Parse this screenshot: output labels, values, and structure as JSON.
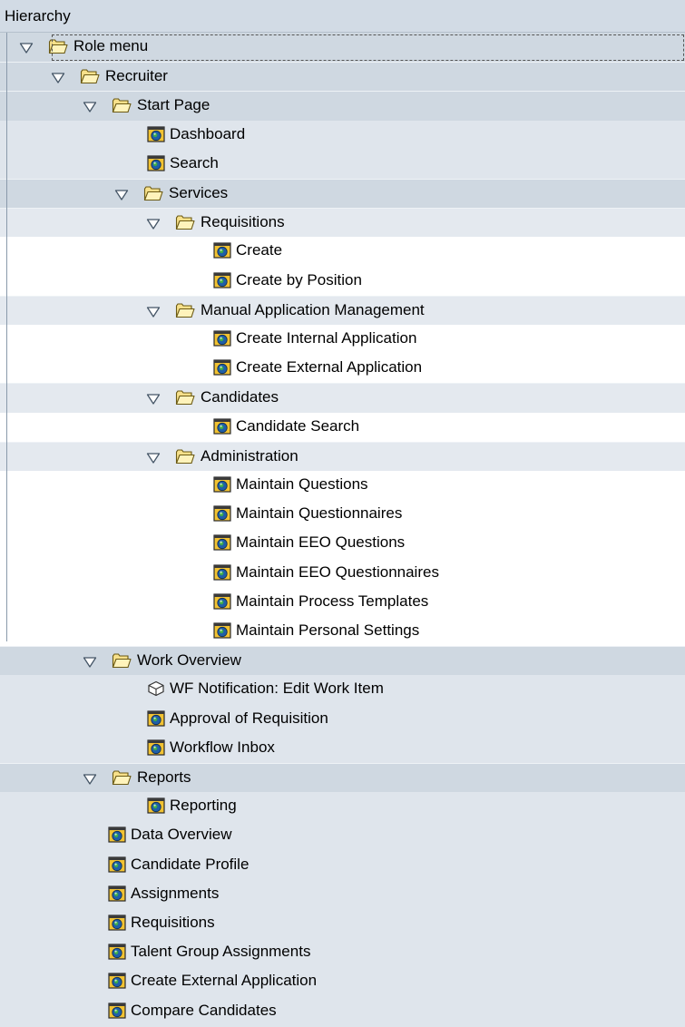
{
  "header": {
    "title": "Hierarchy"
  },
  "tree": [
    {
      "label": "Role menu",
      "level": 0,
      "kind": "folder",
      "expanded": true,
      "selected": true
    },
    {
      "label": "Recruiter",
      "level": 1,
      "kind": "folder",
      "expanded": true
    },
    {
      "label": "Start Page",
      "level": 2,
      "kind": "folder",
      "expanded": true
    },
    {
      "label": "Dashboard",
      "level": 3,
      "kind": "app"
    },
    {
      "label": "Search",
      "level": 3,
      "kind": "app"
    },
    {
      "label": "Services",
      "level": 3,
      "kind": "folder",
      "expanded": true
    },
    {
      "label": "Requisitions",
      "level": 4,
      "kind": "folder",
      "expanded": true
    },
    {
      "label": "Create",
      "level": 5,
      "kind": "app"
    },
    {
      "label": "Create by Position",
      "level": 5,
      "kind": "app"
    },
    {
      "label": "Manual Application Management",
      "level": 4,
      "kind": "folder",
      "expanded": true
    },
    {
      "label": "Create Internal Application",
      "level": 5,
      "kind": "app"
    },
    {
      "label": "Create External Application",
      "level": 5,
      "kind": "app"
    },
    {
      "label": "Candidates",
      "level": 4,
      "kind": "folder",
      "expanded": true
    },
    {
      "label": "Candidate Search",
      "level": 5,
      "kind": "app"
    },
    {
      "label": "Administration",
      "level": 4,
      "kind": "folder",
      "expanded": true
    },
    {
      "label": "Maintain Questions",
      "level": 5,
      "kind": "app"
    },
    {
      "label": "Maintain Questionnaires",
      "level": 5,
      "kind": "app"
    },
    {
      "label": "Maintain EEO Questions",
      "level": 5,
      "kind": "app"
    },
    {
      "label": "Maintain EEO Questionnaires",
      "level": 5,
      "kind": "app"
    },
    {
      "label": "Maintain Process Templates",
      "level": 5,
      "kind": "app"
    },
    {
      "label": "Maintain Personal Settings",
      "level": 5,
      "kind": "app"
    },
    {
      "label": "Work Overview",
      "level": 2,
      "kind": "folder",
      "expanded": true
    },
    {
      "label": "WF Notification: Edit Work Item",
      "level": 3,
      "kind": "workitem"
    },
    {
      "label": "Approval of Requisition",
      "level": 3,
      "kind": "app"
    },
    {
      "label": "Workflow Inbox",
      "level": 3,
      "kind": "app"
    },
    {
      "label": "Reports",
      "level": 2,
      "kind": "folder",
      "expanded": true
    },
    {
      "label": "Reporting",
      "level": 3,
      "kind": "app"
    },
    {
      "label": "Data Overview",
      "level": 2,
      "kind": "app"
    },
    {
      "label": "Candidate Profile",
      "level": 2,
      "kind": "app"
    },
    {
      "label": "Assignments",
      "level": 2,
      "kind": "app"
    },
    {
      "label": "Requisitions",
      "level": 2,
      "kind": "app"
    },
    {
      "label": "Talent Group Assignments",
      "level": 2,
      "kind": "app"
    },
    {
      "label": "Create External Application",
      "level": 2,
      "kind": "app"
    },
    {
      "label": "Compare Candidates",
      "level": 2,
      "kind": "app"
    }
  ]
}
